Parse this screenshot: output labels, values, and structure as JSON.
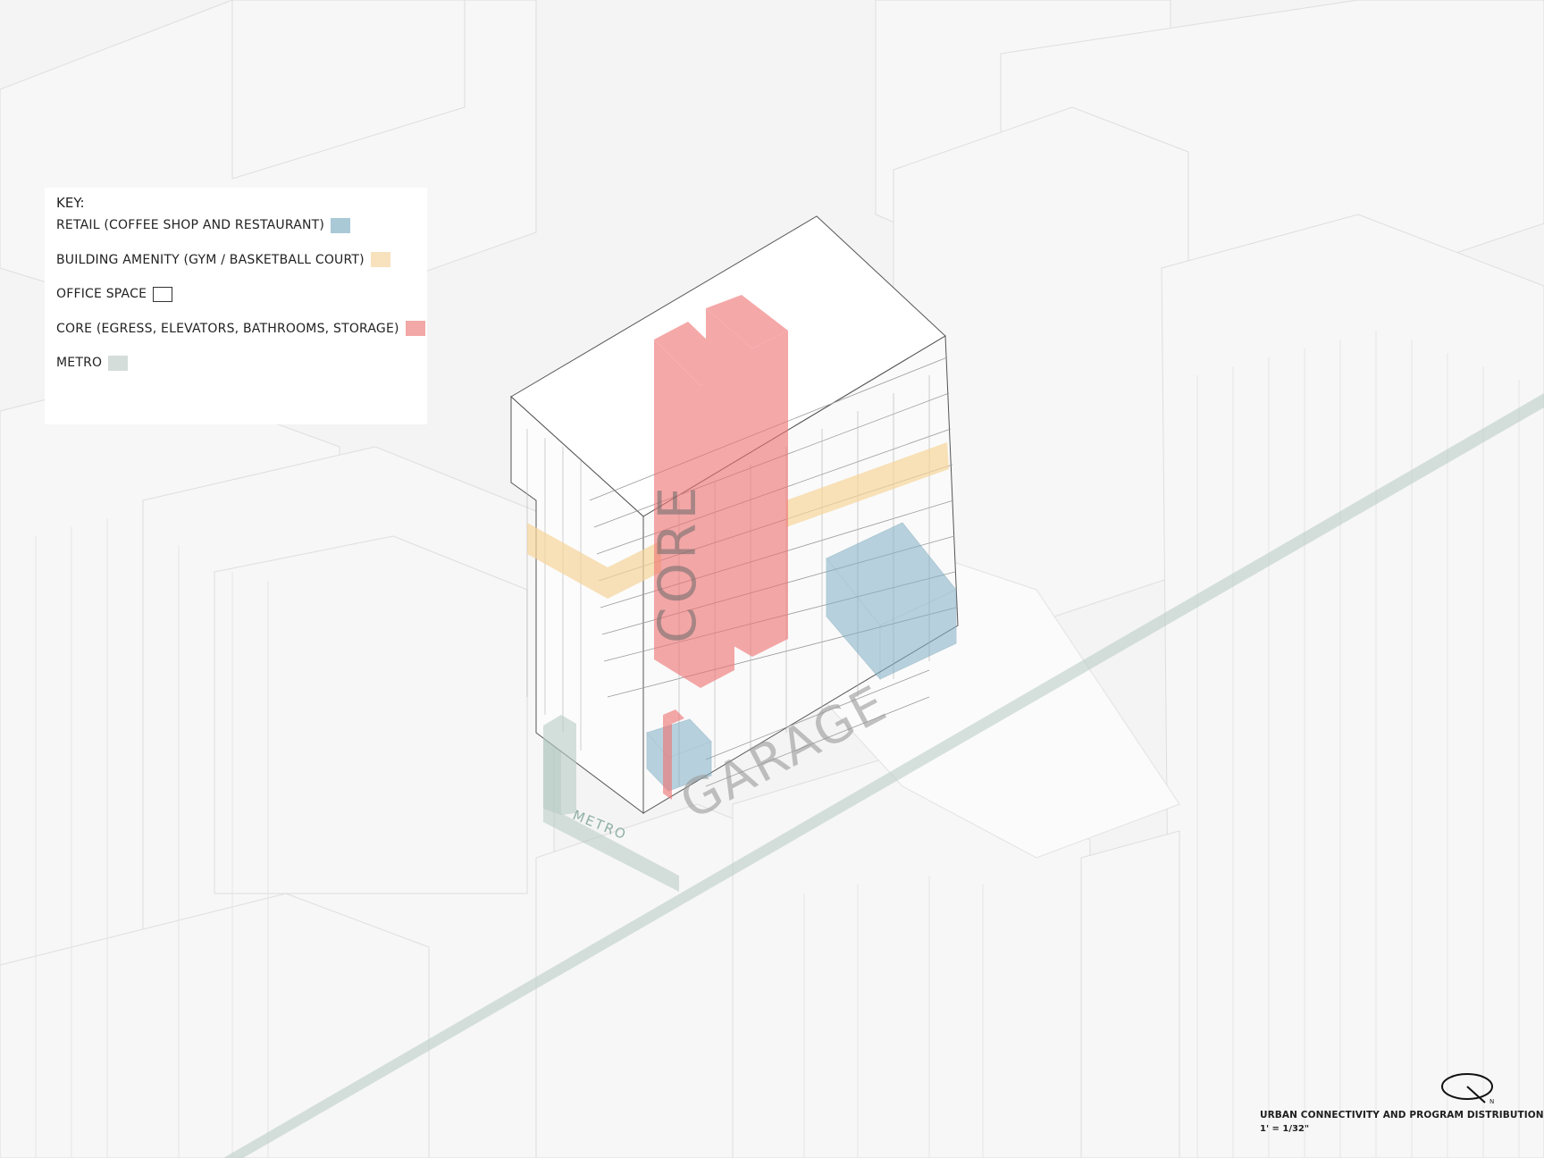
{
  "key": {
    "title": "KEY:",
    "items": [
      {
        "label": "RETAIL (COFFEE SHOP AND RESTAURANT)",
        "color": "#a9c9d6"
      },
      {
        "label": "BUILDING AMENITY (GYM / BASKETBALL COURT)",
        "color": "#f8e1bd"
      },
      {
        "label": "OFFICE SPACE",
        "color": "#ffffff"
      },
      {
        "label": "CORE (EGRESS, ELEVATORS, BATHROOMS, STORAGE)",
        "color": "#f2a8a6"
      },
      {
        "label": "METRO",
        "color": "#d4ddda"
      }
    ]
  },
  "labels": {
    "core": "CORE",
    "garage": "GARAGE",
    "metro": "METRO"
  },
  "caption": {
    "title": "URBAN CONNECTIVITY AND PROGRAM DISTRIBUTION",
    "scale": "1' = 1/32\""
  },
  "north": "N",
  "colors": {
    "background": "#f4f4f4",
    "core": "#ef7373",
    "retail": "#7fb0c6",
    "amenity": "#f6d49a",
    "metro": "#b7cbc4",
    "linework": "#c9c9c9"
  }
}
